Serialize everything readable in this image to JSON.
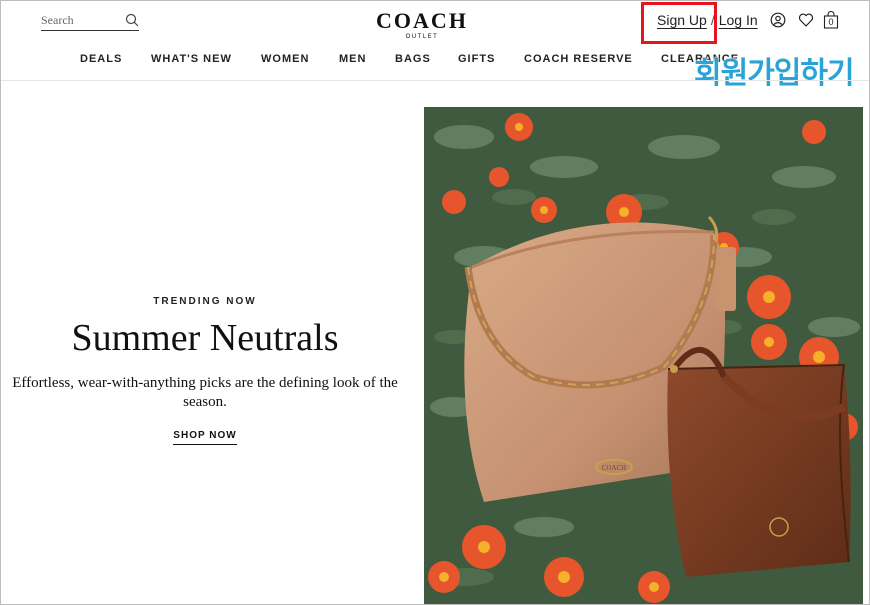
{
  "header": {
    "search_placeholder": "Search",
    "logo": {
      "title": "COACH",
      "subtitle": "OUTLET"
    },
    "auth": {
      "signup": "Sign Up",
      "separator": "/",
      "login": "Log In"
    },
    "bag_count": "0",
    "icons": [
      "search-icon",
      "account-icon",
      "heart-icon",
      "bag-icon"
    ]
  },
  "nav": {
    "items": [
      "DEALS",
      "WHAT'S NEW",
      "WOMEN",
      "MEN",
      "BAGS",
      "GIFTS",
      "COACH RESERVE",
      "CLEARANCE"
    ]
  },
  "annotation": {
    "text": "회원가입하기",
    "color": "#2aa4d6",
    "box_color": "#e8141b"
  },
  "hero": {
    "eyebrow": "TRENDING NOW",
    "headline": "Summer Neutrals",
    "body": "Effortless, wear-with-anything picks are the defining look of the season.",
    "cta": "SHOP NOW",
    "image_alt": "Tan and brown leather handbags on a bed of orange flowers",
    "bag_logo": "COACH"
  },
  "colors": {
    "accent_red": "#e8141b",
    "annotation_blue": "#2aa4d6"
  }
}
